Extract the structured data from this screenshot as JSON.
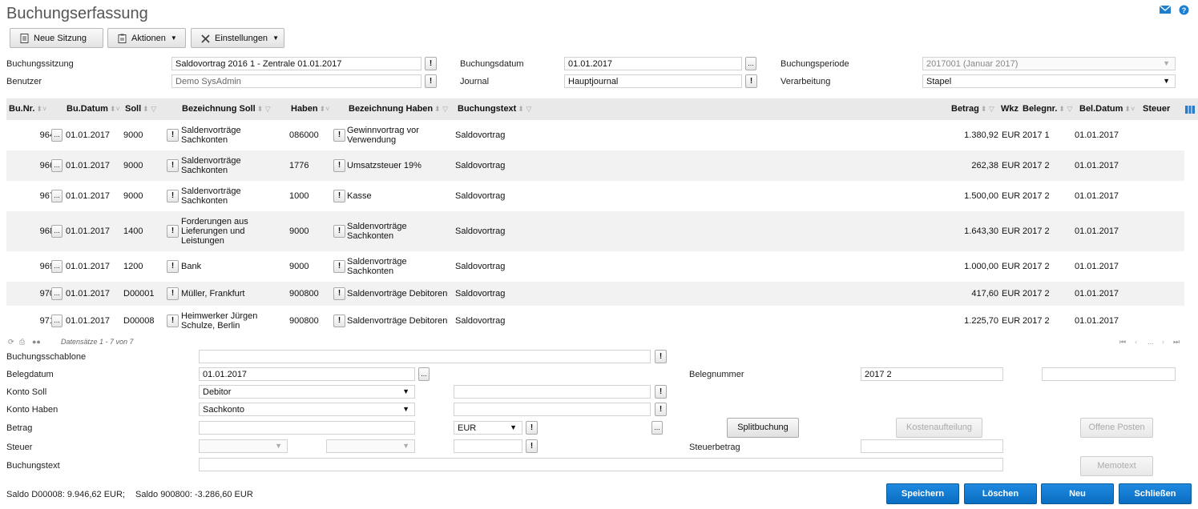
{
  "app": {
    "title": "Buchungserfassung"
  },
  "toolbar": {
    "new_session": "Neue Sitzung",
    "actions": "Aktionen",
    "settings": "Einstellungen"
  },
  "header_form": {
    "session_label": "Buchungssitzung",
    "session_value": "Saldovortrag 2016 1 - Zentrale 01.01.2017",
    "user_label": "Benutzer",
    "user_value": "Demo SysAdmin",
    "date_label": "Buchungsdatum",
    "date_value": "01.01.2017",
    "journal_label": "Journal",
    "journal_value": "Hauptjournal",
    "period_label": "Buchungsperiode",
    "period_value": "2017001 (Januar 2017)",
    "processing_label": "Verarbeitung",
    "processing_value": "Stapel"
  },
  "table": {
    "columns": [
      "Bu.Nr.",
      "Bu.Datum",
      "Soll",
      "Bezeichnung Soll",
      "Haben",
      "Bezeichnung Haben",
      "Buchungstext",
      "Betrag",
      "Wkz",
      "Belegnr.",
      "Bel.Datum",
      "Steuer"
    ],
    "rows": [
      {
        "nr": "964",
        "datum": "01.01.2017",
        "soll": "9000",
        "bez_soll": "Saldenvorträge Sachkonten",
        "haben": "086000",
        "bez_haben": "Gewinnvortrag vor Verwendung",
        "text": "Saldovortrag",
        "betrag": "1.380,92",
        "wkz": "EUR",
        "belegnr": "2017 1",
        "beldatum": "01.01.2017"
      },
      {
        "nr": "966",
        "datum": "01.01.2017",
        "soll": "9000",
        "bez_soll": "Saldenvorträge Sachkonten",
        "haben": "1776",
        "bez_haben": "Umsatzsteuer 19%",
        "text": "Saldovortrag",
        "betrag": "262,38",
        "wkz": "EUR",
        "belegnr": "2017 2",
        "beldatum": "01.01.2017"
      },
      {
        "nr": "967",
        "datum": "01.01.2017",
        "soll": "9000",
        "bez_soll": "Saldenvorträge Sachkonten",
        "haben": "1000",
        "bez_haben": "Kasse",
        "text": "Saldovortrag",
        "betrag": "1.500,00",
        "wkz": "EUR",
        "belegnr": "2017 2",
        "beldatum": "01.01.2017"
      },
      {
        "nr": "968",
        "datum": "01.01.2017",
        "soll": "1400",
        "bez_soll": "Forderungen aus Lieferungen und Leistungen",
        "haben": "9000",
        "bez_haben": "Saldenvorträge Sachkonten",
        "text": "Saldovortrag",
        "betrag": "1.643,30",
        "wkz": "EUR",
        "belegnr": "2017 2",
        "beldatum": "01.01.2017"
      },
      {
        "nr": "969",
        "datum": "01.01.2017",
        "soll": "1200",
        "bez_soll": "Bank",
        "haben": "9000",
        "bez_haben": "Saldenvorträge Sachkonten",
        "text": "Saldovortrag",
        "betrag": "1.000,00",
        "wkz": "EUR",
        "belegnr": "2017 2",
        "beldatum": "01.01.2017"
      },
      {
        "nr": "970",
        "datum": "01.01.2017",
        "soll": "D00001",
        "bez_soll": "Müller, Frankfurt",
        "haben": "900800",
        "bez_haben": "Saldenvorträge Debitoren",
        "text": "Saldovortrag",
        "betrag": "417,60",
        "wkz": "EUR",
        "belegnr": "2017 2",
        "beldatum": "01.01.2017"
      },
      {
        "nr": "971",
        "datum": "01.01.2017",
        "soll": "D00008",
        "bez_soll": "Heimwerker Jürgen Schulze, Berlin",
        "haben": "900800",
        "bez_haben": "Saldenvorträge Debitoren",
        "text": "Saldovortrag",
        "betrag": "1.225,70",
        "wkz": "EUR",
        "belegnr": "2017 2",
        "beldatum": "01.01.2017"
      }
    ],
    "records": "Datensätze 1 - 7 von 7",
    "pager_ellipsis": "..."
  },
  "entry_form": {
    "template_label": "Buchungsschablone",
    "template_value": "",
    "belegdatum_label": "Belegdatum",
    "belegdatum_value": "01.01.2017",
    "belegnummer_label": "Belegnummer",
    "belegnummer_value": "2017 2",
    "konto_soll_label": "Konto Soll",
    "konto_soll_value": "Debitor",
    "konto_haben_label": "Konto Haben",
    "konto_haben_value": "Sachkonto",
    "betrag_label": "Betrag",
    "currency_value": "EUR",
    "splitbuchung": "Splitbuchung",
    "kostenaufteilung": "Kostenaufteilung",
    "offene_posten": "Offene Posten",
    "steuer_label": "Steuer",
    "steuerbetrag_label": "Steuerbetrag",
    "buchungstext_label": "Buchungstext",
    "memotext": "Memotext"
  },
  "footer": {
    "saldo1": "Saldo D00008: 9.946,62 EUR;",
    "saldo2": "Saldo 900800: -3.286,60 EUR",
    "speichern": "Speichern",
    "loeschen": "Löschen",
    "neu": "Neu",
    "schliessen": "Schließen"
  },
  "colors": {
    "accent": "#0a6dc2",
    "header_bg": "#e9e9e9",
    "row_alt": "#f2f2f2"
  },
  "icons": {
    "mail": "mail-icon",
    "help": "help-icon"
  }
}
